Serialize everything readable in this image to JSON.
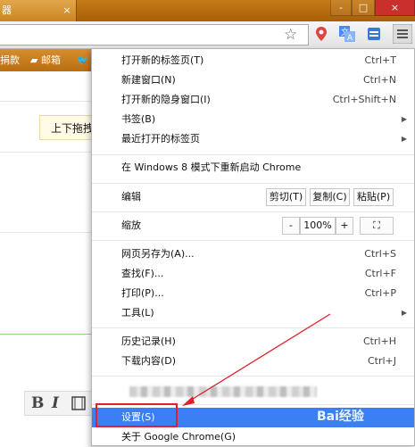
{
  "browser": {
    "tab_title": "器",
    "tab_close": "×",
    "window_controls": [
      "-",
      "□",
      "×"
    ],
    "bookmarks": [
      {
        "label": "捐款"
      },
      {
        "label": "邮箱"
      }
    ],
    "toolbar_icons": [
      "star-icon",
      "map-pin-icon",
      "translate-icon",
      "cast-icon",
      "menu-icon"
    ]
  },
  "page": {
    "drag_tip": "上下拖拽",
    "format_buttons": [
      "B",
      "I"
    ]
  },
  "menu": {
    "items_group1": [
      {
        "label": "打开新的标签页(T)",
        "shortcut": "Ctrl+T"
      },
      {
        "label": "新建窗口(N)",
        "shortcut": "Ctrl+N"
      },
      {
        "label": "打开新的隐身窗口(I)",
        "shortcut": "Ctrl+Shift+N"
      },
      {
        "label": "书签(B)",
        "arrow": "▶"
      },
      {
        "label": "最近打开的标签页",
        "arrow": "▶"
      }
    ],
    "restart": "在 Windows 8 模式下重新启动 Chrome",
    "edit": {
      "label": "编辑",
      "cut": "剪切(T)",
      "copy": "复制(C)",
      "paste": "粘贴(P)"
    },
    "zoom": {
      "label": "缩放",
      "minus": "-",
      "value": "100%",
      "plus": "+",
      "fullscreen": "⛶"
    },
    "items_group2": [
      {
        "label": "网页另存为(A)...",
        "shortcut": "Ctrl+S"
      },
      {
        "label": "查找(F)...",
        "shortcut": "Ctrl+F"
      },
      {
        "label": "打印(P)...",
        "shortcut": "Ctrl+P"
      },
      {
        "label": "工具(L)",
        "arrow": "▶"
      }
    ],
    "items_group3": [
      {
        "label": "历史记录(H)",
        "shortcut": "Ctrl+H"
      },
      {
        "label": "下载内容(D)",
        "shortcut": "Ctrl+J"
      }
    ],
    "settings": "设置(S)",
    "about": "关于 Google Chrome(G)"
  },
  "annotation": {
    "highlight_color": "#e0202a",
    "watermark": "Bai经验"
  },
  "colors": {
    "title_bar": "#b96d12",
    "selection": "#3c7ef4"
  }
}
